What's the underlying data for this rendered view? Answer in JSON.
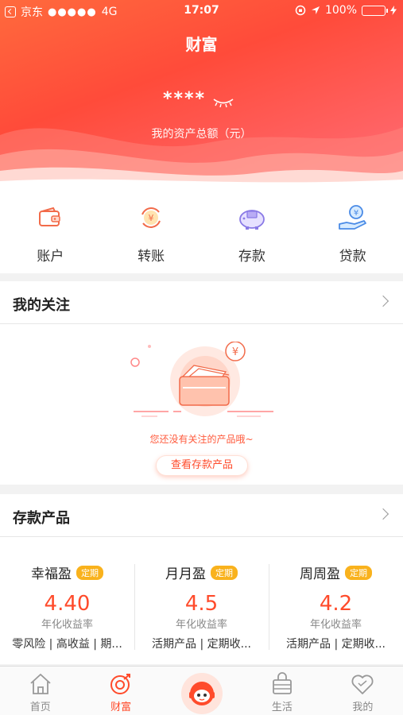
{
  "status_bar": {
    "carrier": "京东",
    "signal": "●●●●●",
    "network": "4G",
    "time": "17:07",
    "battery": "100%"
  },
  "header": {
    "title": "财富",
    "amount_masked": "****",
    "amount_label": "我的资产总额（元）"
  },
  "quick_actions": [
    {
      "label": "账户",
      "icon": "wallet-icon"
    },
    {
      "label": "转账",
      "icon": "transfer-icon"
    },
    {
      "label": "存款",
      "icon": "piggy-bank-icon"
    },
    {
      "label": "贷款",
      "icon": "loan-hand-icon"
    }
  ],
  "follow": {
    "title": "我的关注",
    "empty_text": "您还没有关注的产品哦~",
    "button_label": "查看存款产品"
  },
  "deposit": {
    "title": "存款产品",
    "products": [
      {
        "name": "幸福盈",
        "badge": "定期",
        "rate": "4.40",
        "rate_label": "年化收益率",
        "desc": "零风险 | 高收益 | 期..."
      },
      {
        "name": "月月盈",
        "badge": "定期",
        "rate": "4.5",
        "rate_label": "年化收益率",
        "desc": "活期产品 | 定期收..."
      },
      {
        "name": "周周盈",
        "badge": "定期",
        "rate": "4.2",
        "rate_label": "年化收益率",
        "desc": "活期产品 | 定期收..."
      }
    ]
  },
  "tabbar": [
    {
      "label": "首页",
      "icon": "home-icon",
      "active": false
    },
    {
      "label": "财富",
      "icon": "wealth-icon",
      "active": true
    },
    {
      "label": "",
      "icon": "robot-avatar-icon",
      "active": false
    },
    {
      "label": "生活",
      "icon": "shopping-bag-icon",
      "active": false
    },
    {
      "label": "我的",
      "icon": "heart-icon",
      "active": false
    }
  ],
  "colors": {
    "accent": "#ff4b2b",
    "badge": "#f9b21d",
    "header_gradient_start": "#ff6a3d",
    "header_gradient_end": "#ff6f7a"
  }
}
